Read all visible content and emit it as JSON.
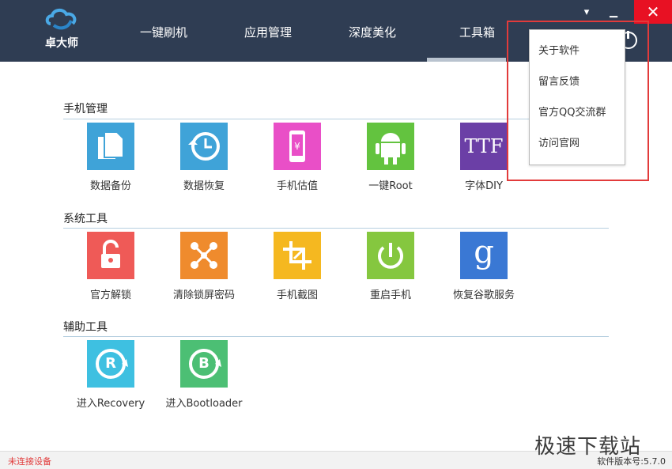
{
  "header": {
    "logo_text": "卓大师",
    "nav": [
      "一键刷机",
      "应用管理",
      "深度美化",
      "工具箱"
    ]
  },
  "window": {
    "close_glyph": "✕",
    "minimize_glyph": "▁",
    "menu_glyph": "▾"
  },
  "sections": [
    {
      "title": "手机管理",
      "tiles": [
        {
          "label": "数据备份",
          "color": "#3fa3d8",
          "icon": "copy-icon"
        },
        {
          "label": "数据恢复",
          "color": "#3fa3d8",
          "icon": "history-icon"
        },
        {
          "label": "手机估值",
          "color": "#e94fc7",
          "icon": "phone-yen-icon"
        },
        {
          "label": "一键Root",
          "color": "#63c33f",
          "icon": "android-root-icon"
        },
        {
          "label": "字体DIY",
          "color": "#6b3fa6",
          "icon": "ttf-icon",
          "text": "TTF"
        }
      ]
    },
    {
      "title": "系统工具",
      "tiles": [
        {
          "label": "官方解锁",
          "color": "#ef5a57",
          "icon": "unlock-icon"
        },
        {
          "label": "清除锁屏密码",
          "color": "#ef8b2d",
          "icon": "pattern-icon"
        },
        {
          "label": "手机截图",
          "color": "#f5b820",
          "icon": "crop-icon"
        },
        {
          "label": "重启手机",
          "color": "#85c73f",
          "icon": "power-icon"
        },
        {
          "label": "恢复谷歌服务",
          "color": "#3a78d4",
          "icon": "google-icon",
          "text": "g"
        }
      ]
    },
    {
      "title": "辅助工具",
      "tiles": [
        {
          "label": "进入Recovery",
          "color": "#3ec0e1",
          "icon": "recovery-icon",
          "text": "R"
        },
        {
          "label": "进入Bootloader",
          "color": "#4cbf74",
          "icon": "bootloader-icon",
          "text": "B"
        }
      ]
    }
  ],
  "dropdown": [
    "关于软件",
    "留言反馈",
    "官方QQ交流群",
    "访问官网"
  ],
  "status": {
    "left": "未连接设备",
    "right": "软件版本号:5.7.0"
  },
  "watermark": "极速下载站"
}
